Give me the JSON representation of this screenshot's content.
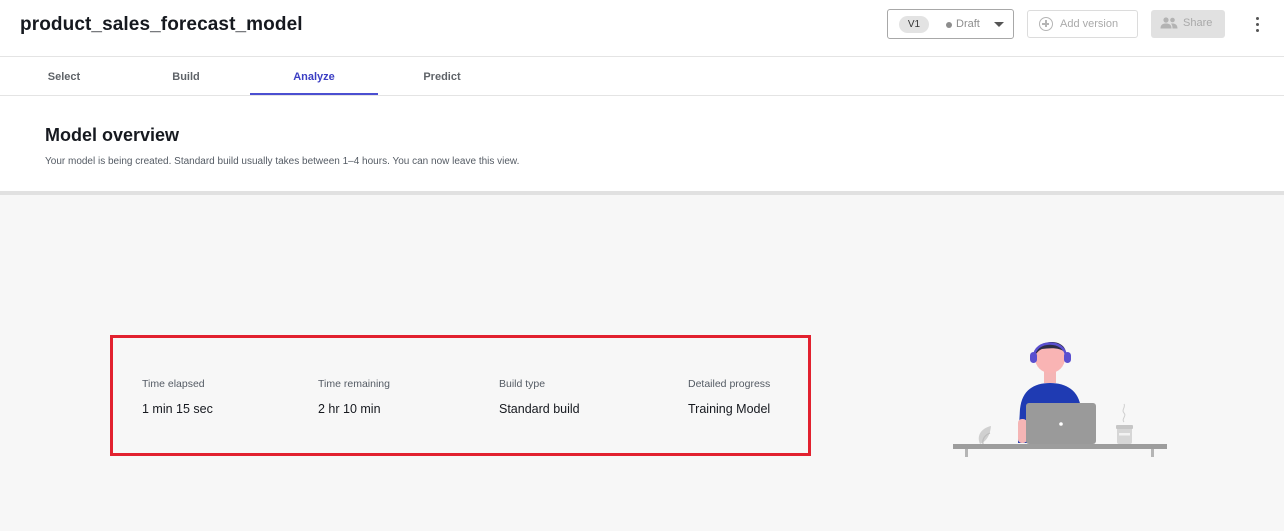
{
  "header": {
    "model_name": "product_sales_forecast_model",
    "version": {
      "label": "V1",
      "status": "Draft"
    },
    "add_version_label": "Add version",
    "share_label": "Share"
  },
  "tabs": [
    {
      "label": "Select",
      "active": false
    },
    {
      "label": "Build",
      "active": false
    },
    {
      "label": "Analyze",
      "active": true
    },
    {
      "label": "Predict",
      "active": false
    }
  ],
  "overview": {
    "title": "Model overview",
    "description": "Your model is being created. Standard build usually takes between 1–4 hours. You can now leave this view."
  },
  "stats": [
    {
      "label": "Time elapsed",
      "value": "1 min 15 sec"
    },
    {
      "label": "Time remaining",
      "value": "2 hr 10 min"
    },
    {
      "label": "Build type",
      "value": "Standard build"
    },
    {
      "label": "Detailed progress",
      "value": "Training Model"
    }
  ],
  "colors": {
    "accent": "#4b4fd1",
    "highlight_border": "#e2212f",
    "illustration_shirt": "#1f3bb3",
    "illustration_headphones": "#5a4fcf"
  },
  "icons": {
    "add_version": "plus-circle-icon",
    "share": "people-icon",
    "more": "kebab-icon",
    "dropdown": "caret-down-icon"
  }
}
